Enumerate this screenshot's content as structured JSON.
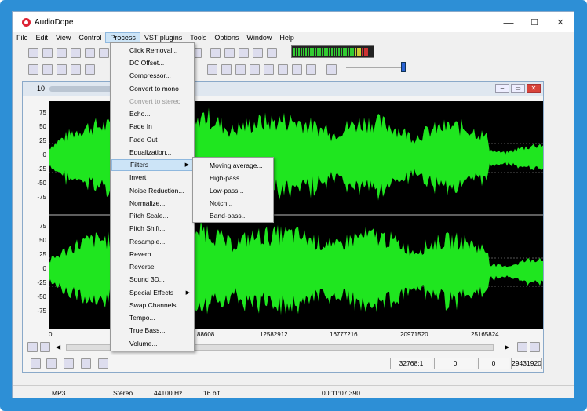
{
  "window": {
    "title": "AudioDope",
    "minimize": "—",
    "maximize": "☐",
    "close": "✕"
  },
  "menubar": [
    "File",
    "Edit",
    "View",
    "Control",
    "Process",
    "VST plugins",
    "Tools",
    "Options",
    "Window",
    "Help"
  ],
  "active_menu": "Process",
  "document": {
    "title": "10"
  },
  "y_ticks_top": [
    "75",
    "50",
    "25",
    "0",
    "-25",
    "-50",
    "-75"
  ],
  "y_ticks_bottom": [
    "75",
    "50",
    "25",
    "0",
    "-25",
    "-50",
    "-75"
  ],
  "x_ticks": [
    "0",
    "88608",
    "12582912",
    "16777216",
    "20971520",
    "25165824"
  ],
  "process_menu": [
    {
      "label": "Click Removal...",
      "disabled": false
    },
    {
      "label": "DC Offset...",
      "disabled": false
    },
    {
      "label": "Compressor...",
      "disabled": false
    },
    {
      "label": "Convert to mono",
      "disabled": false
    },
    {
      "label": "Convert to stereo",
      "disabled": true
    },
    {
      "label": "Echo...",
      "disabled": false
    },
    {
      "label": "Fade In",
      "disabled": false
    },
    {
      "label": "Fade Out",
      "disabled": false
    },
    {
      "label": "Equalization...",
      "disabled": false
    },
    {
      "label": "Filters",
      "disabled": false,
      "submenu": true,
      "highlighted": true
    },
    {
      "label": "Invert",
      "disabled": false
    },
    {
      "label": "Noise Reduction...",
      "disabled": false
    },
    {
      "label": "Normalize...",
      "disabled": false
    },
    {
      "label": "Pitch Scale...",
      "disabled": false
    },
    {
      "label": "Pitch Shift...",
      "disabled": false
    },
    {
      "label": "Resample...",
      "disabled": false
    },
    {
      "label": "Reverb...",
      "disabled": false
    },
    {
      "label": "Reverse",
      "disabled": false
    },
    {
      "label": "Sound 3D...",
      "disabled": false
    },
    {
      "label": "Special Effects",
      "disabled": false,
      "submenu": true
    },
    {
      "label": "Swap Channels",
      "disabled": false
    },
    {
      "label": "Tempo...",
      "disabled": false
    },
    {
      "label": "True Bass...",
      "disabled": false
    },
    {
      "label": "Volume...",
      "disabled": false
    }
  ],
  "filters_submenu": [
    "Moving average...",
    "High-pass...",
    "Low-pass...",
    "Notch...",
    "Band-pass..."
  ],
  "value_boxes": [
    "32768:1",
    "0",
    "0",
    "29431920"
  ],
  "status": {
    "format": "MP3",
    "channels": "Stereo",
    "rate": "44100 Hz",
    "bits": "16 bit",
    "time": "00:11:07,390"
  },
  "colors": {
    "waveform": "#1fe61f",
    "background": "#000000",
    "frame": "#2d8fd6",
    "highlight": "#cce4f7"
  }
}
